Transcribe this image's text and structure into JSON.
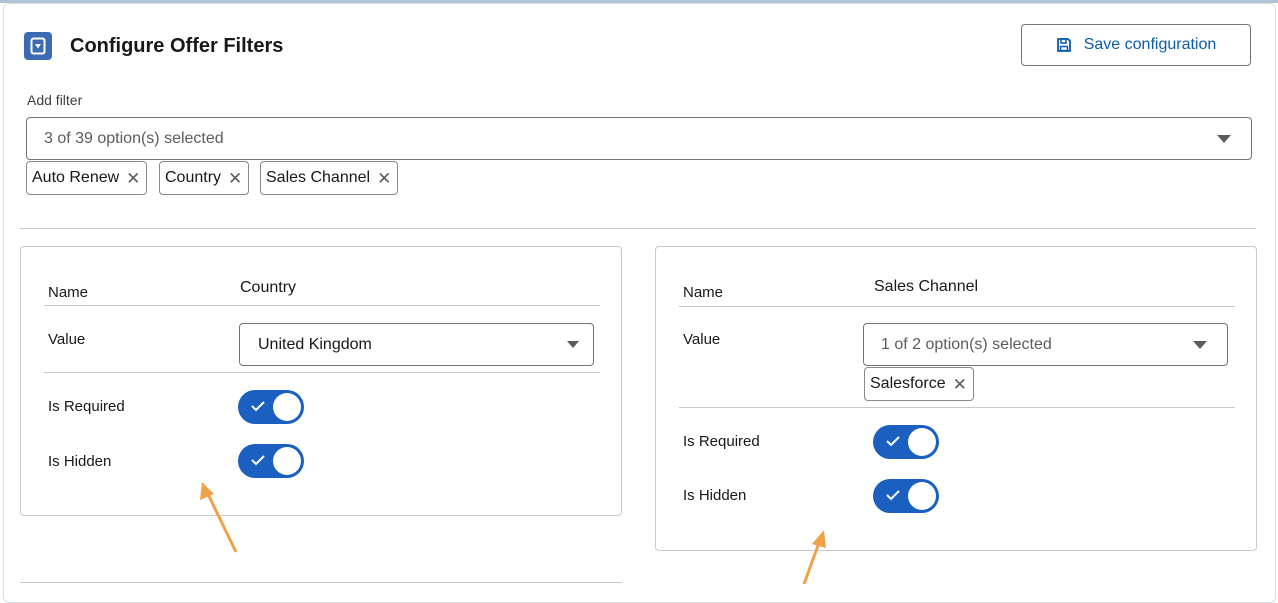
{
  "header": {
    "title": "Configure Offer Filters",
    "icon": "document-filter-icon",
    "save_label": "Save configuration",
    "save_icon": "save-icon"
  },
  "add_filter": {
    "label": "Add filter",
    "summary": "3 of 39 option(s) selected",
    "selected": [
      "Auto Renew",
      "Country",
      "Sales Channel"
    ]
  },
  "cards": [
    {
      "name_label": "Name",
      "name_value": "Country",
      "value_label": "Value",
      "value_text": "United Kingdom",
      "required_label": "Is Required",
      "hidden_label": "Is Hidden",
      "is_required": true,
      "is_hidden": true
    },
    {
      "name_label": "Name",
      "name_value": "Sales Channel",
      "value_label": "Value",
      "value_text": "1 of 2 option(s) selected",
      "selected_pills": [
        "Salesforce"
      ],
      "required_label": "Is Required",
      "hidden_label": "Is Hidden",
      "is_required": true,
      "is_hidden": true
    }
  ],
  "colors": {
    "brand_blue": "#0b5cab",
    "toggle_on": "#1b5fc1",
    "annotation_arrow": "#f0a24a"
  }
}
